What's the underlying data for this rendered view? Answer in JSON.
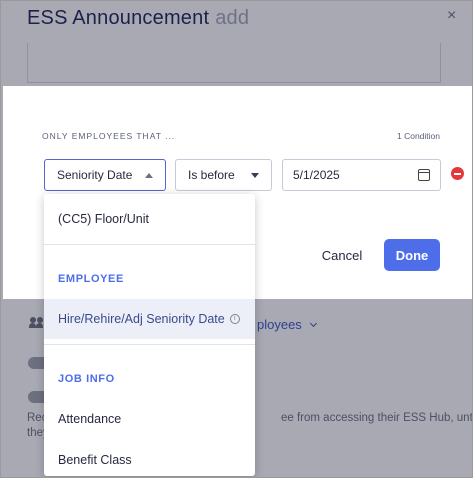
{
  "background": {
    "title": "ESS Announcement",
    "title_suffix": "add",
    "close_glyph": "×",
    "employees_link": "ployees",
    "description_line1_left": "Rec",
    "description_line1_right": "ee from accessing their ESS Hub, until",
    "description_line2": "they"
  },
  "condition": {
    "heading": "ONLY EMPLOYEES THAT ...",
    "count": "1 Condition",
    "field_value": "Seniority Date",
    "operator_value": "Is before",
    "date_value": "5/1/2025",
    "cancel_label": "Cancel",
    "done_label": "Done"
  },
  "dropdown": {
    "item_floor": "(CC5) Floor/Unit",
    "group_employee": "EMPLOYEE",
    "item_hire": "Hire/Rehire/Adj Seniority Date",
    "info_glyph": "i",
    "group_job": "JOB INFO",
    "item_attendance": "Attendance",
    "item_benefit": "Benefit Class"
  },
  "colors": {
    "accent": "#4d6ee8",
    "danger": "#e5383b",
    "title": "#1f2456"
  }
}
